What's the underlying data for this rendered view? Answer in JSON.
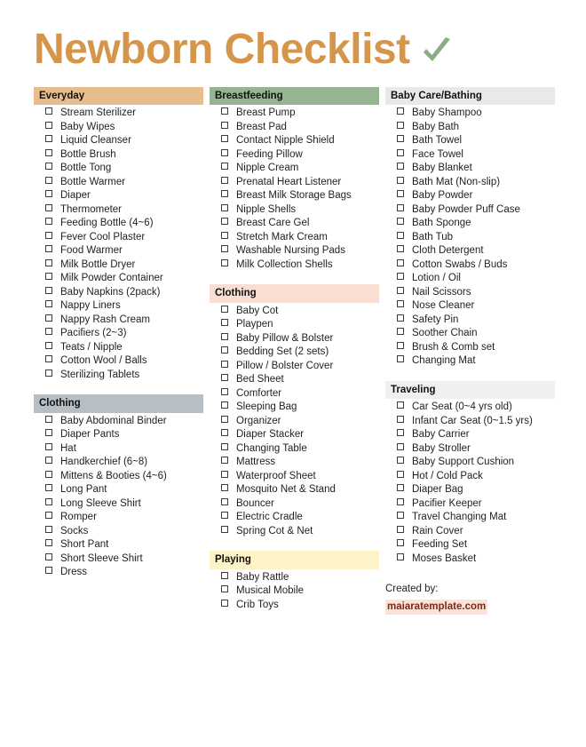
{
  "document": {
    "title": "Newborn Checklist",
    "title_color": "#d5954b",
    "check_icon": "green-check-icon",
    "check_color": "#8aad84"
  },
  "columns": [
    {
      "id": "column-1",
      "sections": [
        {
          "id": "everyday",
          "header": "Everyday",
          "header_style": "h-tan",
          "header_color": "#e8bd8e",
          "items": [
            "Stream Sterilizer",
            "Baby Wipes",
            "Liquid Cleanser",
            "Bottle Brush",
            "Bottle Tong",
            "Bottle Warmer",
            "Diaper",
            "Thermometer",
            "Feeding Bottle (4~6)",
            "Fever Cool Plaster",
            "Food Warmer",
            "Milk Bottle Dryer",
            "Milk Powder Container",
            "Baby Napkins (2pack)",
            "Nappy Liners",
            "Nappy Rash Cream",
            "Pacifiers (2~3)",
            "Teats / Nipple",
            "Cotton Wool / Balls",
            "Sterilizing Tablets"
          ]
        },
        {
          "id": "clothing-1",
          "header": "Clothing",
          "header_style": "h-bluegray",
          "header_color": "#b7bfc4",
          "items": [
            "Baby Abdominal Binder",
            "Diaper Pants",
            "Hat",
            "Handkerchief (6~8)",
            "Mittens & Booties (4~6)",
            "Long Pant",
            "Long Sleeve Shirt",
            "Romper",
            "Socks",
            "Short Pant",
            "Short Sleeve Shirt",
            "Dress"
          ]
        }
      ]
    },
    {
      "id": "column-2",
      "sections": [
        {
          "id": "breastfeeding",
          "header": "Breastfeeding",
          "header_style": "h-green",
          "header_color": "#96b392",
          "items": [
            "Breast Pump",
            "Breast Pad",
            "Contact Nipple Shield",
            "Feeding Pillow",
            "Nipple Cream",
            "Prenatal Heart Listener",
            "Breast Milk Storage Bags",
            "Nipple Shells",
            "Breast Care Gel",
            "Stretch Mark Cream",
            "Washable Nursing Pads",
            "Milk Collection Shells"
          ]
        },
        {
          "id": "clothing-2",
          "header": "Clothing",
          "header_style": "h-pink",
          "header_color": "#f8ded3",
          "items": [
            "Baby Cot",
            "Playpen",
            "Baby Pillow & Bolster",
            "Bedding Set (2 sets)",
            "Pillow / Bolster Cover",
            "Bed Sheet",
            "Comforter",
            "Sleeping Bag",
            "Organizer",
            "Diaper Stacker",
            "Changing Table",
            "Mattress",
            "Waterproof Sheet",
            "Mosquito Net & Stand",
            "Bouncer",
            "Electric Cradle",
            "Spring Cot & Net"
          ]
        },
        {
          "id": "playing",
          "header": "Playing",
          "header_style": "h-yellow",
          "header_color": "#fdf3c6",
          "items": [
            "Baby Rattle",
            "Musical Mobile",
            "Crib Toys"
          ]
        }
      ]
    },
    {
      "id": "column-3",
      "sections": [
        {
          "id": "baby-care-bathing",
          "header": "Baby Care/Bathing",
          "header_style": "h-gray",
          "header_color": "#e9e9e9",
          "items": [
            "Baby Shampoo",
            "Baby Bath",
            "Bath Towel",
            "Face Towel",
            "Baby Blanket",
            "Bath Mat (Non-slip)",
            "Baby Powder",
            "Baby Powder Puff Case",
            "Bath Sponge",
            "Bath Tub",
            "Cloth Detergent",
            "Cotton Swabs / Buds",
            "Lotion / Oil",
            "Nail Scissors",
            "Nose Cleaner",
            "Safety Pin",
            "Soother Chain",
            "Brush & Comb set",
            "Changing Mat"
          ]
        },
        {
          "id": "traveling",
          "header": "Traveling",
          "header_style": "h-lightgray",
          "header_color": "#f0f0f0",
          "items": [
            "Car Seat (0~4 yrs old)",
            "Infant Car Seat (0~1.5 yrs)",
            "Baby Carrier",
            "Baby Stroller",
            "Baby Support Cushion",
            "Hot / Cold Pack",
            "Diaper Bag",
            "Pacifier Keeper",
            "Travel Changing Mat",
            "Rain Cover",
            "Feeding Set",
            "Moses Basket"
          ]
        }
      ]
    }
  ],
  "footer": {
    "label": "Created by:",
    "site": "maiaratemplate.com",
    "site_color": "#7b2b16",
    "site_highlight": "#fbe3da"
  }
}
